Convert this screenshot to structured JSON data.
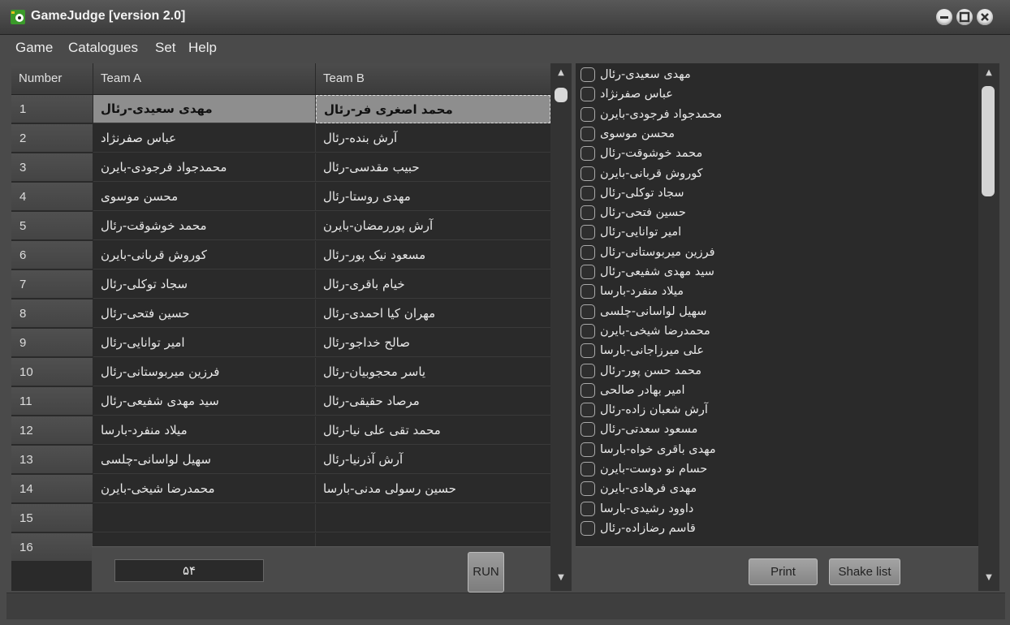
{
  "window": {
    "title": "GameJudge [version 2.0]"
  },
  "menu": {
    "items": [
      "Game",
      "Catalogues",
      "Set",
      "Help"
    ]
  },
  "table": {
    "headers": [
      "Number",
      "Team A",
      "Team B"
    ],
    "rows": [
      {
        "num": "1",
        "a": "مهدی سعیدی-رئال",
        "b": "محمد اصغری فر-رئال"
      },
      {
        "num": "2",
        "a": "عباس صفرنژاد",
        "b": "آرش بنده-رئال"
      },
      {
        "num": "3",
        "a": "محمدجواد فرجودی-بایرن",
        "b": "حبیب مقدسی-رئال"
      },
      {
        "num": "4",
        "a": "محسن موسوی",
        "b": "مهدی روستا-رئال"
      },
      {
        "num": "5",
        "a": "محمد خوشوقت-رئال",
        "b": "آرش پوررمضان-بایرن"
      },
      {
        "num": "6",
        "a": "کوروش قربانی-بایرن",
        "b": "مسعود نیک پور-رئال"
      },
      {
        "num": "7",
        "a": "سجاد توکلی-رئال",
        "b": "خیام باقری-رئال"
      },
      {
        "num": "8",
        "a": "حسین فتحی-رئال",
        "b": "مهران کیا احمدی-رئال"
      },
      {
        "num": "9",
        "a": "امیر توانایی-رئال",
        "b": "صالح خداجو-رئال"
      },
      {
        "num": "10",
        "a": "فرزین میربوستانی-رئال",
        "b": "یاسر محجوبیان-رئال"
      },
      {
        "num": "11",
        "a": "سید مهدی شفیعی-رئال",
        "b": "مرصاد حقیقی-رئال"
      },
      {
        "num": "12",
        "a": "میلاد منفرد-بارسا",
        "b": "محمد تقی علی نیا-رئال"
      },
      {
        "num": "13",
        "a": "سهیل لواسانی-چلسی",
        "b": "آرش آذرنیا-رئال"
      },
      {
        "num": "14",
        "a": "محمدرضا شیخی-بایرن",
        "b": "حسین رسولی مدنی-بارسا"
      },
      {
        "num": "15",
        "a": "",
        "b": ""
      },
      {
        "num": "16",
        "a": "",
        "b": ""
      }
    ]
  },
  "count_value": "۵۴",
  "run_label": "RUN",
  "player_list": [
    "مهدی سعیدی-رئال",
    "عباس صفرنژاد",
    "محمدجواد فرجودی-بایرن",
    "محسن موسوی",
    "محمد خوشوقت-رئال",
    "کوروش قربانی-بایرن",
    "سجاد توکلی-رئال",
    "حسین فتحی-رئال",
    "امیر توانایی-رئال",
    "فرزین میربوستانی-رئال",
    "سید مهدی شفیعی-رئال",
    "میلاد منفرد-بارسا",
    "سهیل لواسانی-چلسی",
    "محمدرضا شیخی-بایرن",
    "علی میرزاجانی-بارسا",
    "محمد حسن پور-رئال",
    "امیر بهادر صالحی",
    "آرش شعبان زاده-رئال",
    "مسعود سعدتی-رئال",
    "مهدی باقری خواه-بارسا",
    "حسام نو دوست-بایرن",
    "مهدی فرهادی-بایرن",
    "داوود رشیدی-بارسا",
    "قاسم رضازاده-رئال"
  ],
  "buttons": {
    "print": "Print",
    "shake": "Shake list"
  },
  "colors": {
    "background": "#4a4a4a",
    "table": "#2a2a2a",
    "selected_row": "#8e8e8e"
  }
}
